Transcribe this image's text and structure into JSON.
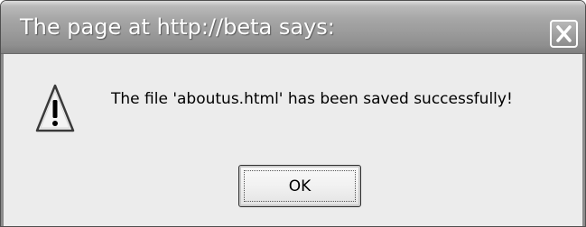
{
  "dialog": {
    "title": "The page at http://beta says:",
    "message": "The file 'aboutus.html' has been saved successfully!",
    "ok_label": "OK",
    "icons": {
      "warning": "warning-icon",
      "close": "close-icon"
    }
  },
  "colors": {
    "titlebar": "#9b9b9b",
    "title_text": "#ffffff",
    "body_background": "#ececec",
    "message_text": "#000000"
  }
}
